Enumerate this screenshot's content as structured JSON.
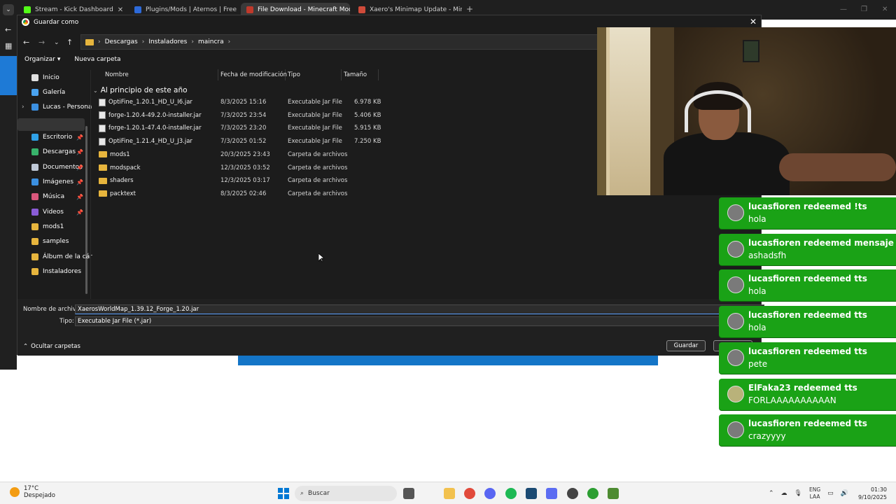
{
  "browser": {
    "tabs": [
      {
        "label": "Stream - Kick Dashboard",
        "color": "#53fc18"
      },
      {
        "label": "Plugins/Mods | Aternos | Free M",
        "color": "#2d6ad9"
      },
      {
        "label": "File Download - Minecraft Mod",
        "color": "#c0392b"
      },
      {
        "label": "Xaero's Minimap Update - Mine",
        "color": "#d04b3a"
      }
    ],
    "new_tab": "+"
  },
  "dialog": {
    "title": "Guardar como",
    "breadcrumb": [
      "Descargas",
      "Instaladores",
      "maincra"
    ],
    "toolbar": {
      "organize": "Organizar ▾",
      "new_folder": "Nueva carpeta"
    },
    "sidebar": [
      {
        "label": "Inicio",
        "icon": "home-icon",
        "color": "#e0e0e0",
        "pinned": false
      },
      {
        "label": "Galería",
        "icon": "gallery-icon",
        "color": "#4aa3f0",
        "pinned": false
      },
      {
        "label": "Lucas - Persona",
        "icon": "cloud-icon",
        "color": "#3b8fe0",
        "pinned": false
      },
      {
        "label": "Escritorio",
        "icon": "desktop-icon",
        "color": "#2fa0e6",
        "pinned": true
      },
      {
        "label": "Descargas",
        "icon": "download-icon",
        "color": "#38b36b",
        "pinned": true
      },
      {
        "label": "Documentos",
        "icon": "document-icon",
        "color": "#bfc8d6",
        "pinned": true
      },
      {
        "label": "Imágenes",
        "icon": "pictures-icon",
        "color": "#3b8fe0",
        "pinned": true
      },
      {
        "label": "Música",
        "icon": "music-icon",
        "color": "#d9577c",
        "pinned": true
      },
      {
        "label": "Videos",
        "icon": "video-icon",
        "color": "#8a5cd6",
        "pinned": true
      },
      {
        "label": "mods1",
        "icon": "folder-icon",
        "color": "#e7b53d",
        "pinned": false
      },
      {
        "label": "samples",
        "icon": "folder-icon",
        "color": "#e7b53d",
        "pinned": false
      },
      {
        "label": "Álbum de la cár",
        "icon": "folder-icon",
        "color": "#e7b53d",
        "pinned": false
      },
      {
        "label": "Instaladores",
        "icon": "folder-icon",
        "color": "#e7b53d",
        "pinned": false
      }
    ],
    "columns": {
      "name": "Nombre",
      "date": "Fecha de modificación",
      "type": "Tipo",
      "size": "Tamaño"
    },
    "group": "Al principio de este año",
    "files": [
      {
        "name": "OptiFine_1.20.1_HD_U_I6.jar",
        "date": "8/3/2025 15:16",
        "type": "Executable Jar File",
        "size": "6.978 KB",
        "kind": "jar"
      },
      {
        "name": "forge-1.20.4-49.2.0-installer.jar",
        "date": "7/3/2025 23:54",
        "type": "Executable Jar File",
        "size": "5.406 KB",
        "kind": "jar"
      },
      {
        "name": "forge-1.20.1-47.4.0-installer.jar",
        "date": "7/3/2025 23:20",
        "type": "Executable Jar File",
        "size": "5.915 KB",
        "kind": "jar"
      },
      {
        "name": "OptiFine_1.21.4_HD_U_J3.jar",
        "date": "7/3/2025 01:52",
        "type": "Executable Jar File",
        "size": "7.250 KB",
        "kind": "jar"
      },
      {
        "name": "mods1",
        "date": "20/3/2025 23:43",
        "type": "Carpeta de archivos",
        "size": "",
        "kind": "folder"
      },
      {
        "name": "modspack",
        "date": "12/3/2025 03:52",
        "type": "Carpeta de archivos",
        "size": "",
        "kind": "folder"
      },
      {
        "name": "shaders",
        "date": "12/3/2025 03:17",
        "type": "Carpeta de archivos",
        "size": "",
        "kind": "folder"
      },
      {
        "name": "packtext",
        "date": "8/3/2025 02:46",
        "type": "Carpeta de archivos",
        "size": "",
        "kind": "folder"
      }
    ],
    "form": {
      "filename_label": "Nombre de archivo:",
      "filename_value": "XaerosWorldMap_1.39.12_Forge_1.20.jar",
      "type_label": "Tipo:",
      "type_value": "Executable Jar File (*.jar)",
      "hide_folders": "Ocultar carpetas",
      "save": "Guardar"
    }
  },
  "alerts": [
    {
      "user": "lucasfioren redeemed !ts",
      "message": "hola"
    },
    {
      "user": "lucasfioren redeemed mensaje de vo",
      "message": "ashadsfh"
    },
    {
      "user": "lucasfioren redeemed tts",
      "message": "hola"
    },
    {
      "user": "lucasfioren redeemed tts",
      "message": "hola"
    },
    {
      "user": "lucasfioren redeemed tts",
      "message": "pete"
    },
    {
      "user": "ElFaka23 redeemed tts",
      "message": "FORLAAAAAAAAAAN"
    },
    {
      "user": "lucasfioren redeemed tts",
      "message": "crazyyyy"
    }
  ],
  "taskbar": {
    "weather_temp": "17°C",
    "weather_desc": "Despejado",
    "search_placeholder": "Buscar",
    "lang_top": "ENG",
    "lang_bottom": "LAA",
    "time": "01:30",
    "date": "9/10/2025",
    "apps": [
      {
        "name": "explorer-icon",
        "color": "#f2c14e"
      },
      {
        "name": "chrome-icon",
        "color": "#e14a3b"
      },
      {
        "name": "discord-icon",
        "color": "#5865f2"
      },
      {
        "name": "spotify-icon",
        "color": "#1db954"
      },
      {
        "name": "steam-icon",
        "color": "#1b4a73"
      },
      {
        "name": "vpn-icon",
        "color": "#5b6cf2"
      },
      {
        "name": "game-icon",
        "color": "#444444"
      },
      {
        "name": "xbox-icon",
        "color": "#2c9e32"
      },
      {
        "name": "minecraft-icon",
        "color": "#4d8b31"
      }
    ]
  }
}
